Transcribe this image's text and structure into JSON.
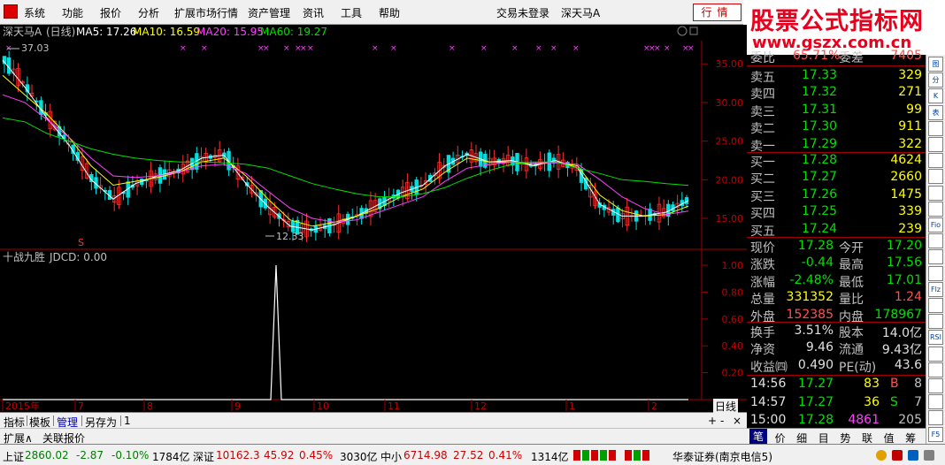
{
  "menu": {
    "items": [
      "系统",
      "功能",
      "报价",
      "分析",
      "扩展市场行情",
      "资产管理",
      "资讯",
      "工具",
      "帮助"
    ],
    "trade_status": "交易未登录",
    "stock_name": "深天马A",
    "quote_button": "行情"
  },
  "watermark": {
    "title": "股票公式指标网",
    "url": "www.gszx.com.cn"
  },
  "main_chart": {
    "header_name": "深天马A",
    "period": "(日线)",
    "ma5": "MA5: 17.26",
    "ma10": "MA10: 16.59",
    "ma20": "MA20: 15.95",
    "ma60": "MA60: 19.27",
    "high_label": "37.03",
    "low_label": "12.33",
    "y_ticks": [
      "35.00",
      "30.00",
      "25.00",
      "20.00",
      "15.00"
    ],
    "s_marker": "S",
    "colors": {
      "ma5": "#ffffff",
      "ma10": "#ffff00",
      "ma20": "#ff40ff",
      "ma60": "#00e000",
      "up": "#ff3030",
      "down": "#00e0e0",
      "axis": "#a00000"
    }
  },
  "chart_data": {
    "type": "line",
    "title": "深天马A (日线)",
    "series": [
      {
        "name": "MA5",
        "values": [
          35.5,
          32,
          28,
          24.5,
          20,
          17.5,
          19.5,
          20.5,
          21.2,
          22.8,
          23.2,
          19.5,
          16.5,
          14,
          13.5,
          14.2,
          15.3,
          16.8,
          18.3,
          19.3,
          21.8,
          23.3,
          22.3,
          22.5,
          21.8,
          22.5,
          21.5,
          16.8,
          15.3,
          15.3,
          15.8,
          17.3
        ]
      },
      {
        "name": "MA10",
        "values": [
          33.5,
          31,
          28.5,
          25.5,
          21.8,
          19.3,
          19.8,
          20.3,
          21,
          22.3,
          22.8,
          20.5,
          17.5,
          14.8,
          14,
          14.5,
          15.3,
          16.3,
          17.8,
          18.8,
          21,
          22.8,
          22.3,
          22.3,
          22,
          22.3,
          21.8,
          18,
          16,
          15.3,
          15.5,
          16.6
        ]
      },
      {
        "name": "MA20",
        "values": [
          31,
          30,
          27.8,
          25.5,
          22.8,
          20.5,
          20.3,
          20.5,
          21,
          21.8,
          22,
          20.8,
          18.5,
          16.3,
          15,
          14.5,
          14.8,
          15.8,
          16.8,
          17.8,
          19.8,
          21.5,
          22,
          22.3,
          22.2,
          22.2,
          22,
          20,
          17.8,
          16.3,
          15.5,
          15.95
        ]
      },
      {
        "name": "MA60",
        "values": [
          28,
          27.5,
          26,
          25,
          24,
          23.3,
          22.8,
          22.5,
          22.3,
          22.3,
          22.2,
          22,
          21.5,
          20.5,
          19.5,
          18.8,
          18.2,
          17.8,
          17.8,
          18.2,
          19,
          20.2,
          21.2,
          22,
          22.3,
          22.3,
          21.5,
          20.8,
          20,
          19.8,
          19.5,
          19.27
        ]
      }
    ],
    "x_ticks": [
      "2015年",
      "7",
      "8",
      "9",
      "10",
      "11",
      "12",
      "1",
      "2"
    ],
    "ylim": [
      11,
      38
    ],
    "high": 37.03,
    "low": 12.33
  },
  "indicator": {
    "name": "十战九胜",
    "jdcd": "JDCD: 0.00",
    "y_ticks": [
      "1.00",
      "0.80",
      "0.60",
      "0.40",
      "0.20"
    ],
    "spike_value": 1.0
  },
  "quote_panel": {
    "wei_bi_label": "委比",
    "wei_bi": "65.71%",
    "wei_cha_label": "委差",
    "wei_cha": "7405",
    "asks": [
      {
        "label": "卖五",
        "price": "17.33",
        "vol": "329"
      },
      {
        "label": "卖四",
        "price": "17.32",
        "vol": "271"
      },
      {
        "label": "卖三",
        "price": "17.31",
        "vol": "99"
      },
      {
        "label": "卖二",
        "price": "17.30",
        "vol": "911"
      },
      {
        "label": "卖一",
        "price": "17.29",
        "vol": "322"
      }
    ],
    "bids": [
      {
        "label": "买一",
        "price": "17.28",
        "vol": "4624"
      },
      {
        "label": "买二",
        "price": "17.27",
        "vol": "2660"
      },
      {
        "label": "买三",
        "price": "17.26",
        "vol": "1475"
      },
      {
        "label": "买四",
        "price": "17.25",
        "vol": "339"
      },
      {
        "label": "买五",
        "price": "17.24",
        "vol": "239"
      }
    ],
    "stats": [
      {
        "l1": "现价",
        "v1": "17.28",
        "c1": "green",
        "l2": "今开",
        "v2": "17.20",
        "c2": "green"
      },
      {
        "l1": "涨跌",
        "v1": "-0.44",
        "c1": "green",
        "l2": "最高",
        "v2": "17.56",
        "c2": "green"
      },
      {
        "l1": "涨幅",
        "v1": "-2.48%",
        "c1": "green",
        "l2": "最低",
        "v2": "17.01",
        "c2": "green"
      },
      {
        "l1": "总量",
        "v1": "331352",
        "c1": "yellow",
        "l2": "量比",
        "v2": "1.24",
        "c2": "red"
      },
      {
        "l1": "外盘",
        "v1": "152385",
        "c1": "red",
        "l2": "内盘",
        "v2": "178967",
        "c2": "green"
      }
    ],
    "fundamentals": [
      {
        "l1": "换手",
        "v1": "3.51%",
        "l2": "股本",
        "v2": "14.0亿"
      },
      {
        "l1": "净资",
        "v1": "9.46",
        "l2": "流通",
        "v2": "9.43亿"
      },
      {
        "l1": "收益㈣",
        "v1": "0.490",
        "l2": "PE(动)",
        "v2": "43.6"
      }
    ],
    "ticks": [
      {
        "time": "14:56",
        "price": "17.27",
        "vol": "83",
        "bs": "B",
        "bs_color": "red",
        "vol_color": "yellow",
        "n": "8"
      },
      {
        "time": "14:57",
        "price": "17.27",
        "vol": "36",
        "bs": "S",
        "bs_color": "green",
        "vol_color": "yellow",
        "n": "7"
      },
      {
        "time": "15:00",
        "price": "17.28",
        "vol": "4861",
        "bs": "",
        "bs_color": "red",
        "vol_color": "magenta",
        "n": "205"
      }
    ]
  },
  "panel_tabs": [
    "笔",
    "价",
    "细",
    "目",
    "势",
    "联",
    "值",
    "筹"
  ],
  "right_toolbar": [
    "图",
    "分",
    "K",
    "表",
    "",
    "",
    "",
    "",
    "",
    "",
    "Fio",
    "",
    "",
    "",
    "Flz",
    "",
    "",
    "RSI",
    "",
    "",
    "",
    "",
    "",
    "F5"
  ],
  "bottom_tabs": {
    "items": [
      "指标",
      "模板",
      "管理",
      "另存为",
      "1"
    ],
    "selected": "管理",
    "day_line": "日线"
  },
  "ext_bar": {
    "items": [
      "扩展∧",
      "关联报价"
    ]
  },
  "status_bar": {
    "sh_label": "上证",
    "sh_val": "2860.02",
    "sh_chg": "-2.87",
    "sh_pct": "-0.10%",
    "sh_amt": "1784亿",
    "sz_label": "深证",
    "sz_val": "10162.3",
    "sz_chg": "45.92",
    "sz_pct": "0.45%",
    "sz_amt": "3030亿",
    "zx_label": "中小",
    "zx_val": "6714.98",
    "zx_chg": "27.52",
    "zx_pct": "0.41%",
    "zx_amt": "1314亿",
    "broker": "华泰证券(南京电信5)"
  }
}
